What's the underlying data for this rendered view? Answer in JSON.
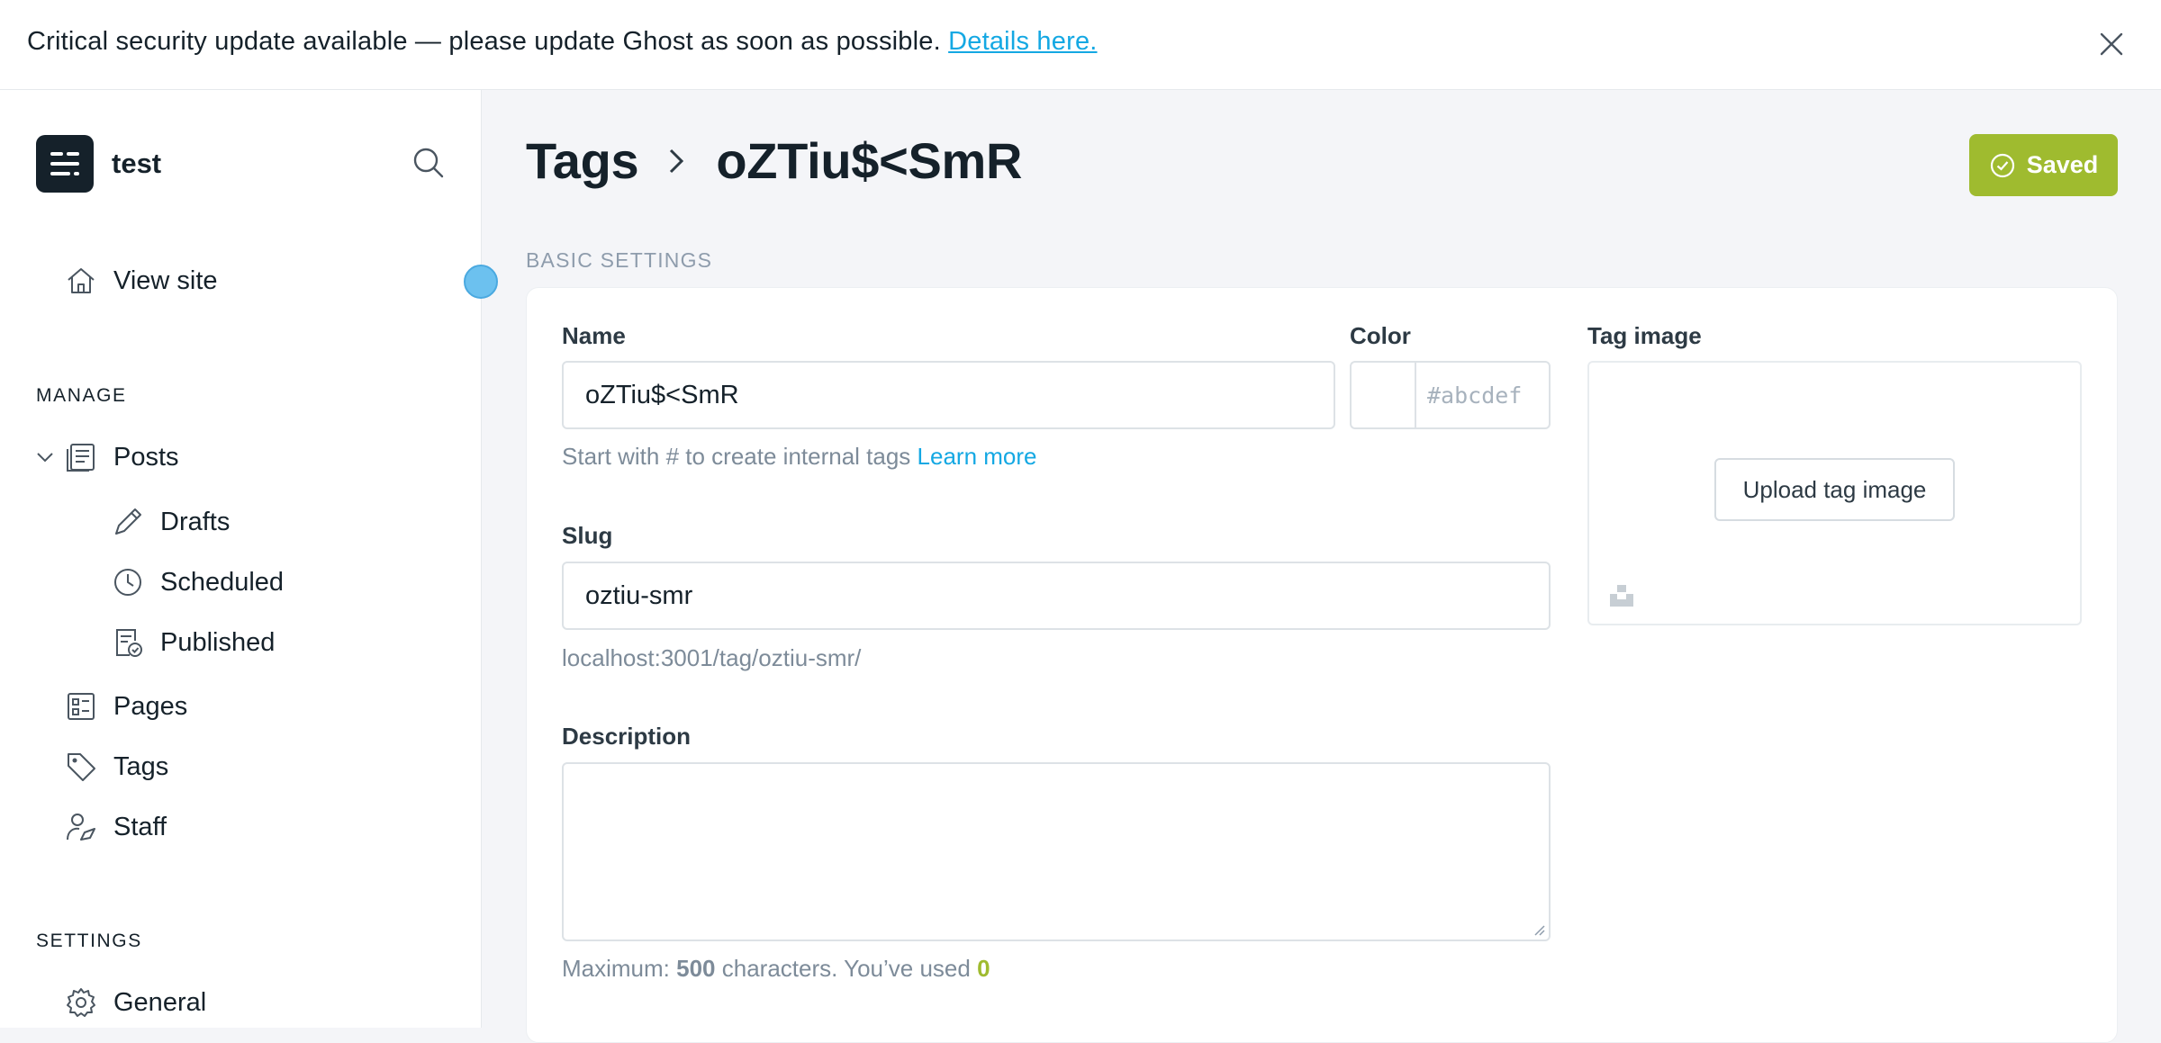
{
  "alert": {
    "message": "Critical security update available — please update Ghost as soon as possible.",
    "link": "Details here."
  },
  "brand": {
    "name": "test"
  },
  "sidebar": {
    "view_site": "View site",
    "manage_label": "MANAGE",
    "posts": "Posts",
    "drafts": "Drafts",
    "scheduled": "Scheduled",
    "published": "Published",
    "pages": "Pages",
    "tags": "Tags",
    "staff": "Staff",
    "settings_label": "SETTINGS",
    "general": "General"
  },
  "header": {
    "crumb_parent": "Tags",
    "crumb_current": "oZTiu$<SmR",
    "saved_label": "Saved"
  },
  "form": {
    "section": "BASIC SETTINGS",
    "name_label": "Name",
    "name_value": "oZTiu$<SmR",
    "name_hint": "Start with # to create internal tags",
    "name_hint_link": "Learn more",
    "color_label": "Color",
    "color_placeholder": "#abcdef",
    "image_label": "Tag image",
    "upload_label": "Upload tag image",
    "slug_label": "Slug",
    "slug_value": "oztiu-smr",
    "slug_url": "localhost:3001/tag/oztiu-smr/",
    "description_label": "Description",
    "description_value": "",
    "max_prefix": "Maximum:",
    "max_value": "500",
    "max_mid": "characters. You’ve used",
    "used_value": "0"
  },
  "colors": {
    "accent": "#9fbb2f",
    "link": "#14a8e3",
    "brand_dark": "#15212a"
  }
}
